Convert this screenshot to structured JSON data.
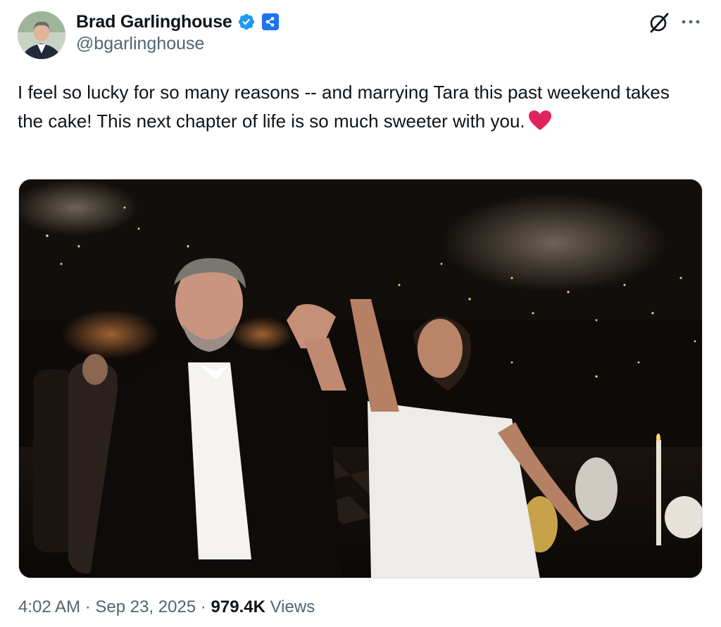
{
  "author": {
    "display_name": "Brad Garlinghouse",
    "handle": "@bgarlinghouse",
    "verified_icon": "verified-badge-icon",
    "affiliate_icon": "ripple-affiliate-icon"
  },
  "tweet": {
    "text": "I feel so lucky for so many reasons -- and marrying Tara this past weekend takes the cake! This next chapter of life is so much sweeter with you.",
    "emoji": "red-heart-icon"
  },
  "meta": {
    "time": "4:02 AM",
    "separator": "·",
    "date": "Sep 23, 2025",
    "views_count": "979.4K",
    "views_label": "Views"
  },
  "icons": {
    "grok": "grok-icon",
    "more": "more-options-icon"
  },
  "colors": {
    "text_primary": "#0f1419",
    "text_secondary": "#536471",
    "verified_blue": "#1d9bf0",
    "heart_red": "#e0245e"
  }
}
